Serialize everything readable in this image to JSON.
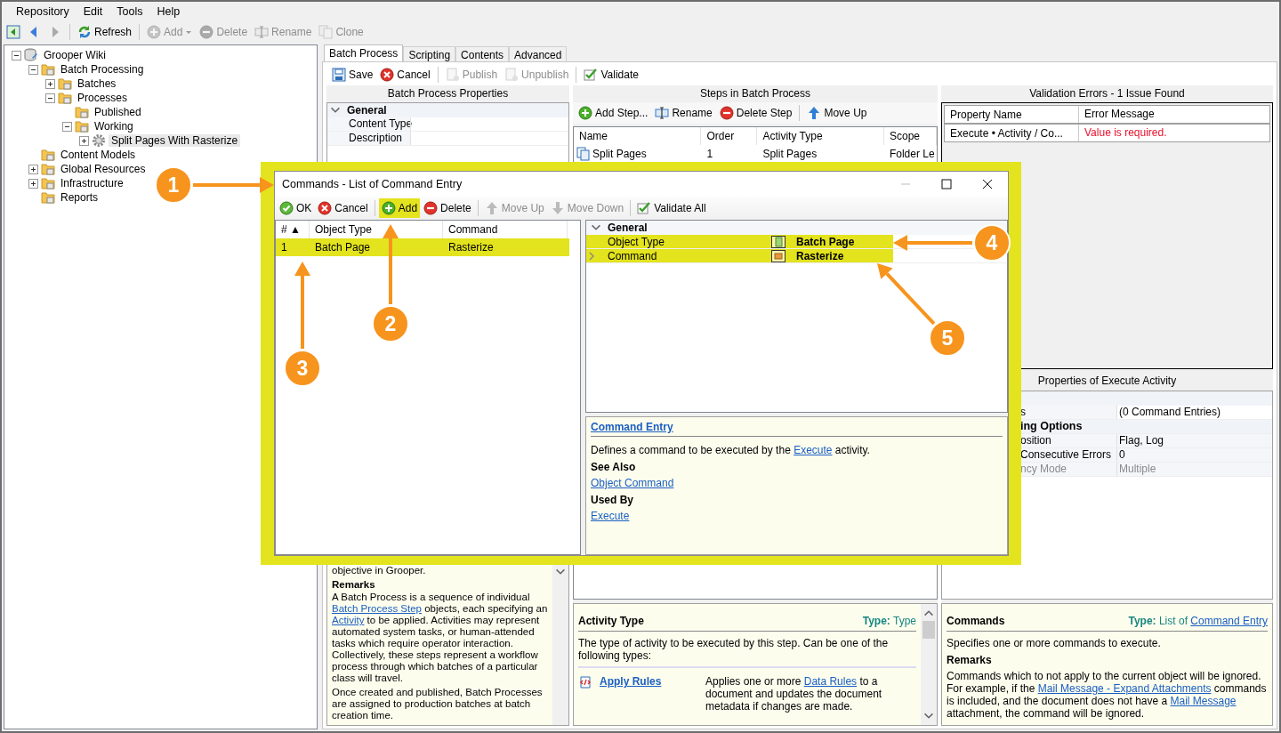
{
  "menu": [
    {
      "label": "Repository"
    },
    {
      "label": "Edit"
    },
    {
      "label": "Tools"
    },
    {
      "label": "Help"
    }
  ],
  "toolbar": [
    {
      "label": "Refresh",
      "kind": "refresh",
      "disabled": false,
      "separator": true
    },
    {
      "label": "Add",
      "kind": "add",
      "disabled": true,
      "dropdown": true
    },
    {
      "label": "Delete",
      "kind": "delete",
      "disabled": true
    },
    {
      "label": "Rename",
      "kind": "rename",
      "disabled": true
    },
    {
      "label": "Clone",
      "kind": "clone",
      "disabled": true
    }
  ],
  "tree": [
    {
      "label": "Grooper Wiki",
      "kind": "database",
      "expanded": true,
      "selected": false,
      "children": [
        {
          "label": "Batch Processing",
          "kind": "folder",
          "expanded": true,
          "selected": false,
          "children": [
            {
              "label": "Batches",
              "kind": "folder",
              "expanded": false,
              "selected": false
            },
            {
              "label": "Processes",
              "kind": "folder",
              "expanded": true,
              "selected": false,
              "children": [
                {
                  "label": "Published",
                  "kind": "folder",
                  "selected": false
                },
                {
                  "label": "Working",
                  "kind": "folder",
                  "expanded": true,
                  "selected": false,
                  "children": [
                    {
                      "label": "Split Pages With Rasterize",
                      "kind": "gear",
                      "expanded": false,
                      "selected": true
                    }
                  ]
                }
              ]
            }
          ]
        },
        {
          "label": "Content Models",
          "kind": "folder",
          "selected": false
        },
        {
          "label": "Global Resources",
          "kind": "folder",
          "expanded": false,
          "selected": false
        },
        {
          "label": "Infrastructure",
          "kind": "folder",
          "expanded": false,
          "selected": false
        },
        {
          "label": "Reports",
          "kind": "folder",
          "selected": false
        }
      ]
    }
  ],
  "tabs": [
    {
      "label": "Batch Process",
      "selected": true
    },
    {
      "label": "Scripting",
      "selected": false
    },
    {
      "label": "Contents",
      "selected": false
    },
    {
      "label": "Advanced",
      "selected": false
    }
  ],
  "editor_toolbar": [
    {
      "label": "Save",
      "kind": "save",
      "disabled": false
    },
    {
      "label": "Cancel",
      "kind": "cancel",
      "disabled": false,
      "separator": true
    },
    {
      "label": "Publish",
      "kind": "publish",
      "disabled": true
    },
    {
      "label": "Unpublish",
      "kind": "publish",
      "disabled": true,
      "separator": true
    },
    {
      "label": "Validate",
      "kind": "validate",
      "disabled": false
    }
  ],
  "properties": {
    "title": "Batch Process Properties",
    "category": {
      "label": "General",
      "expanded": true
    },
    "rows": [
      {
        "label": "Content Type"
      },
      {
        "label": "Description"
      }
    ]
  },
  "steps": {
    "title": "Steps in Batch Process",
    "toolbar": [
      {
        "label": "Add Step...",
        "kind": "add",
        "disabled": false
      },
      {
        "label": "Rename",
        "kind": "rename",
        "disabled": false
      },
      {
        "label": "Delete Step",
        "kind": "delete",
        "disabled": false,
        "separator": true
      },
      {
        "label": "Move Up",
        "kind": "up",
        "disabled": false
      }
    ],
    "columns": [
      "Name",
      "Order",
      "Activity Type",
      "Scope"
    ],
    "rows": [
      [
        "Split Pages",
        "1",
        "Split Pages",
        "Folder Le"
      ]
    ]
  },
  "validation": {
    "title": "Validation Errors - 1 Issue Found",
    "columns": [
      "Property Name",
      "Error Message"
    ],
    "rows": [
      {
        "property": "Execute • Activity / Co...",
        "message": "Value is required.",
        "error": true
      }
    ]
  },
  "execute_properties": {
    "title": "Properties of Execute Activity",
    "rows": [
      {
        "kind": "row",
        "label": "s",
        "value": "(0 Command Entries)",
        "disabled": false
      },
      {
        "kind": "category",
        "label": "ing Options"
      },
      {
        "kind": "row",
        "label": "osition",
        "value": "Flag, Log",
        "disabled": false
      },
      {
        "kind": "row",
        "label": "Consecutive Errors",
        "value": "0",
        "disabled": false
      },
      {
        "kind": "row",
        "label": "ncy Mode",
        "value": "Multiple",
        "disabled": true
      }
    ]
  },
  "help_left": {
    "blocks": [
      {
        "kind": "text",
        "segments": [
          {
            "text": "objective in Grooper."
          }
        ]
      },
      {
        "kind": "heading",
        "text": "Remarks"
      },
      {
        "kind": "text",
        "segments": [
          {
            "text": "A Batch Process is a sequence of individual "
          },
          {
            "text": "Batch Process Step",
            "link": true
          },
          {
            "text": " objects, each specifying an "
          },
          {
            "text": "Activity",
            "link": true
          },
          {
            "text": " to be applied. Activities may represent automated system tasks, or human-attended tasks which require operator interaction. Collectively, these steps represent a workflow process through which batches of a particular class will travel."
          }
        ]
      },
      {
        "kind": "text",
        "segments": [
          {
            "text": "Once created and published, Batch Processes are assigned to production batches at batch creation time."
          }
        ]
      }
    ]
  },
  "help_middle": {
    "title": "Activity Type",
    "type": [
      {
        "text": "Type:",
        "bold": true
      },
      {
        "text": " Type"
      }
    ],
    "blocks": [
      {
        "kind": "text",
        "segments": [
          {
            "text": "The type of activity to be executed by this step. Can be one of the following types:"
          }
        ]
      },
      {
        "kind": "entry",
        "name": "Apply Rules",
        "segments": [
          {
            "text": "Applies one or more "
          },
          {
            "text": "Data Rules",
            "link": true
          },
          {
            "text": " to a document and updates the document metadata if changes are made."
          }
        ]
      }
    ]
  },
  "help_right": {
    "title": "Commands",
    "type": [
      {
        "text": "Type:",
        "bold": true
      },
      {
        "text": " List of "
      },
      {
        "text": "Command Entry",
        "link": true
      }
    ],
    "blocks": [
      {
        "kind": "text",
        "segments": [
          {
            "text": "Specifies one or more commands to execute."
          }
        ]
      },
      {
        "kind": "heading",
        "text": "Remarks"
      },
      {
        "kind": "text",
        "segments": [
          {
            "text": "Commands which to not apply to the current object will be ignored. For example, if the "
          },
          {
            "text": "Mail Message - Expand Attachments",
            "link": true
          },
          {
            "text": " commands is included, and the document does not have a "
          },
          {
            "text": "Mail Message",
            "link": true
          },
          {
            "text": " attachment, the command will be ignored."
          }
        ]
      }
    ]
  },
  "dialog": {
    "title": "Commands - List of Command Entry",
    "toolbar": [
      {
        "label": "OK",
        "kind": "ok",
        "disabled": false
      },
      {
        "label": "Cancel",
        "kind": "cancel",
        "disabled": false,
        "separator": true
      },
      {
        "label": "Add",
        "kind": "add",
        "disabled": false,
        "highlighted": true
      },
      {
        "label": "Delete",
        "kind": "delete",
        "disabled": false,
        "separator": true
      },
      {
        "label": "Move Up",
        "kind": "up",
        "disabled": true
      },
      {
        "label": "Move Down",
        "kind": "down",
        "disabled": true,
        "separator": true
      },
      {
        "label": "Validate All",
        "kind": "validate",
        "disabled": false
      }
    ],
    "columns": [
      "# ▲",
      "Object Type",
      "Command"
    ],
    "rows": [
      {
        "cells": [
          "1",
          "Batch Page",
          "Rasterize"
        ],
        "highlighted": true
      }
    ],
    "grid": {
      "category": {
        "label": "General",
        "expanded": true
      },
      "rows": [
        {
          "label": "Object Type",
          "value": "Batch Page",
          "kind": "page",
          "highlighted": true,
          "expandable": false
        },
        {
          "label": "Command",
          "value": "Rasterize",
          "kind": "command",
          "highlighted": true,
          "expandable": true
        }
      ]
    },
    "help": {
      "title": "Command Entry",
      "blocks": [
        {
          "kind": "text",
          "segments": [
            {
              "text": "Defines a command to be executed by the "
            },
            {
              "text": "Execute",
              "link": true
            },
            {
              "text": " activity."
            }
          ]
        },
        {
          "kind": "heading",
          "text": "See Also"
        },
        {
          "kind": "text",
          "segments": [
            {
              "text": "Object Command",
              "link": true
            }
          ]
        },
        {
          "kind": "heading",
          "text": "Used By"
        },
        {
          "kind": "text",
          "segments": [
            {
              "text": "Execute",
              "link": true
            }
          ]
        }
      ]
    }
  },
  "callouts": [
    {
      "label": "1"
    },
    {
      "label": "2"
    },
    {
      "label": "3"
    },
    {
      "label": "4"
    },
    {
      "label": "5"
    }
  ]
}
